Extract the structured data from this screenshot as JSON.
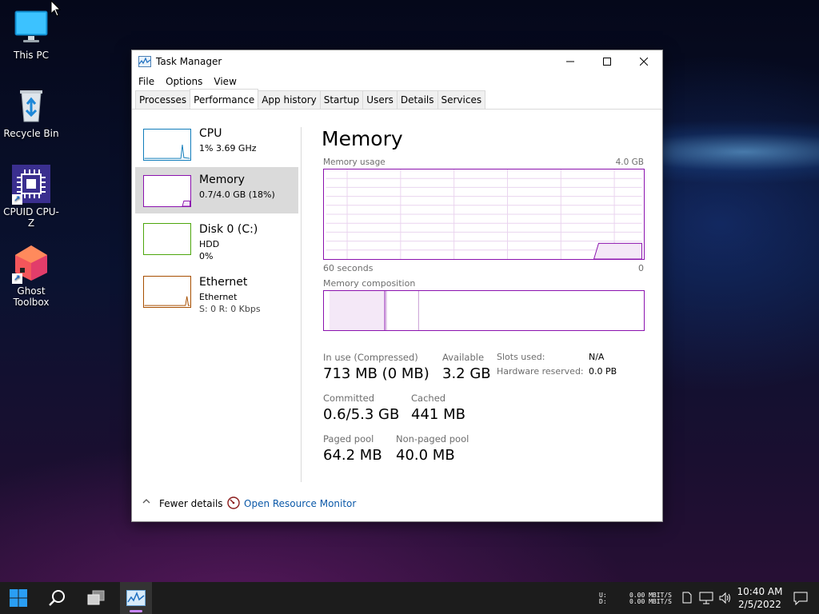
{
  "desktop": {
    "icons": [
      {
        "label": "This PC",
        "icon": "monitor-icon"
      },
      {
        "label": "Recycle Bin",
        "icon": "recycle-bin-icon"
      },
      {
        "label": "CPUID CPU-Z",
        "icon": "cpu-z-icon"
      },
      {
        "label": "Ghost Toolbox",
        "icon": "ghost-toolbox-icon"
      }
    ]
  },
  "window": {
    "title": "Task Manager",
    "menu": [
      "File",
      "Options",
      "View"
    ],
    "tabs": [
      "Processes",
      "Performance",
      "App history",
      "Startup",
      "Users",
      "Details",
      "Services"
    ],
    "active_tab": "Performance",
    "sidebar": [
      {
        "name": "CPU",
        "line1": "1% 3.69 GHz",
        "line2": "",
        "color": "#117dbb"
      },
      {
        "name": "Memory",
        "line1": "0.7/4.0 GB (18%)",
        "line2": "",
        "color": "#8b12ae"
      },
      {
        "name": "Disk 0 (C:)",
        "line1": "HDD",
        "line2": "0%",
        "color": "#4da60c"
      },
      {
        "name": "Ethernet",
        "line1": "Ethernet",
        "line2": "S: 0 R: 0 Kbps",
        "color": "#a74f01"
      }
    ],
    "memory": {
      "title": "Memory",
      "usage_label": "Memory usage",
      "usage_max": "4.0 GB",
      "time_left": "60 seconds",
      "time_right": "0",
      "composition_label": "Memory composition",
      "stats": {
        "in_use_label": "In use (Compressed)",
        "in_use_value": "713 MB (0 MB)",
        "available_label": "Available",
        "available_value": "3.2 GB",
        "committed_label": "Committed",
        "committed_value": "0.6/5.3 GB",
        "cached_label": "Cached",
        "cached_value": "441 MB",
        "paged_label": "Paged pool",
        "paged_value": "64.2 MB",
        "nonpaged_label": "Non-paged pool",
        "nonpaged_value": "40.0 MB",
        "slots_label": "Slots used:",
        "slots_value": "N/A",
        "hw_label": "Hardware reserved:",
        "hw_value": "0.0 PB"
      }
    },
    "footer": {
      "fewer_details": "Fewer details",
      "open_resource_monitor": "Open Resource Monitor"
    }
  },
  "taskbar": {
    "net_label_top": "U:",
    "net_label_bottom": "D:",
    "net_rate_top": "0.00 MBIT/S",
    "net_rate_bottom": "0.00 MBIT/S",
    "time": "10:40 AM",
    "date": "2/5/2022",
    "accent": "#c987ff"
  }
}
